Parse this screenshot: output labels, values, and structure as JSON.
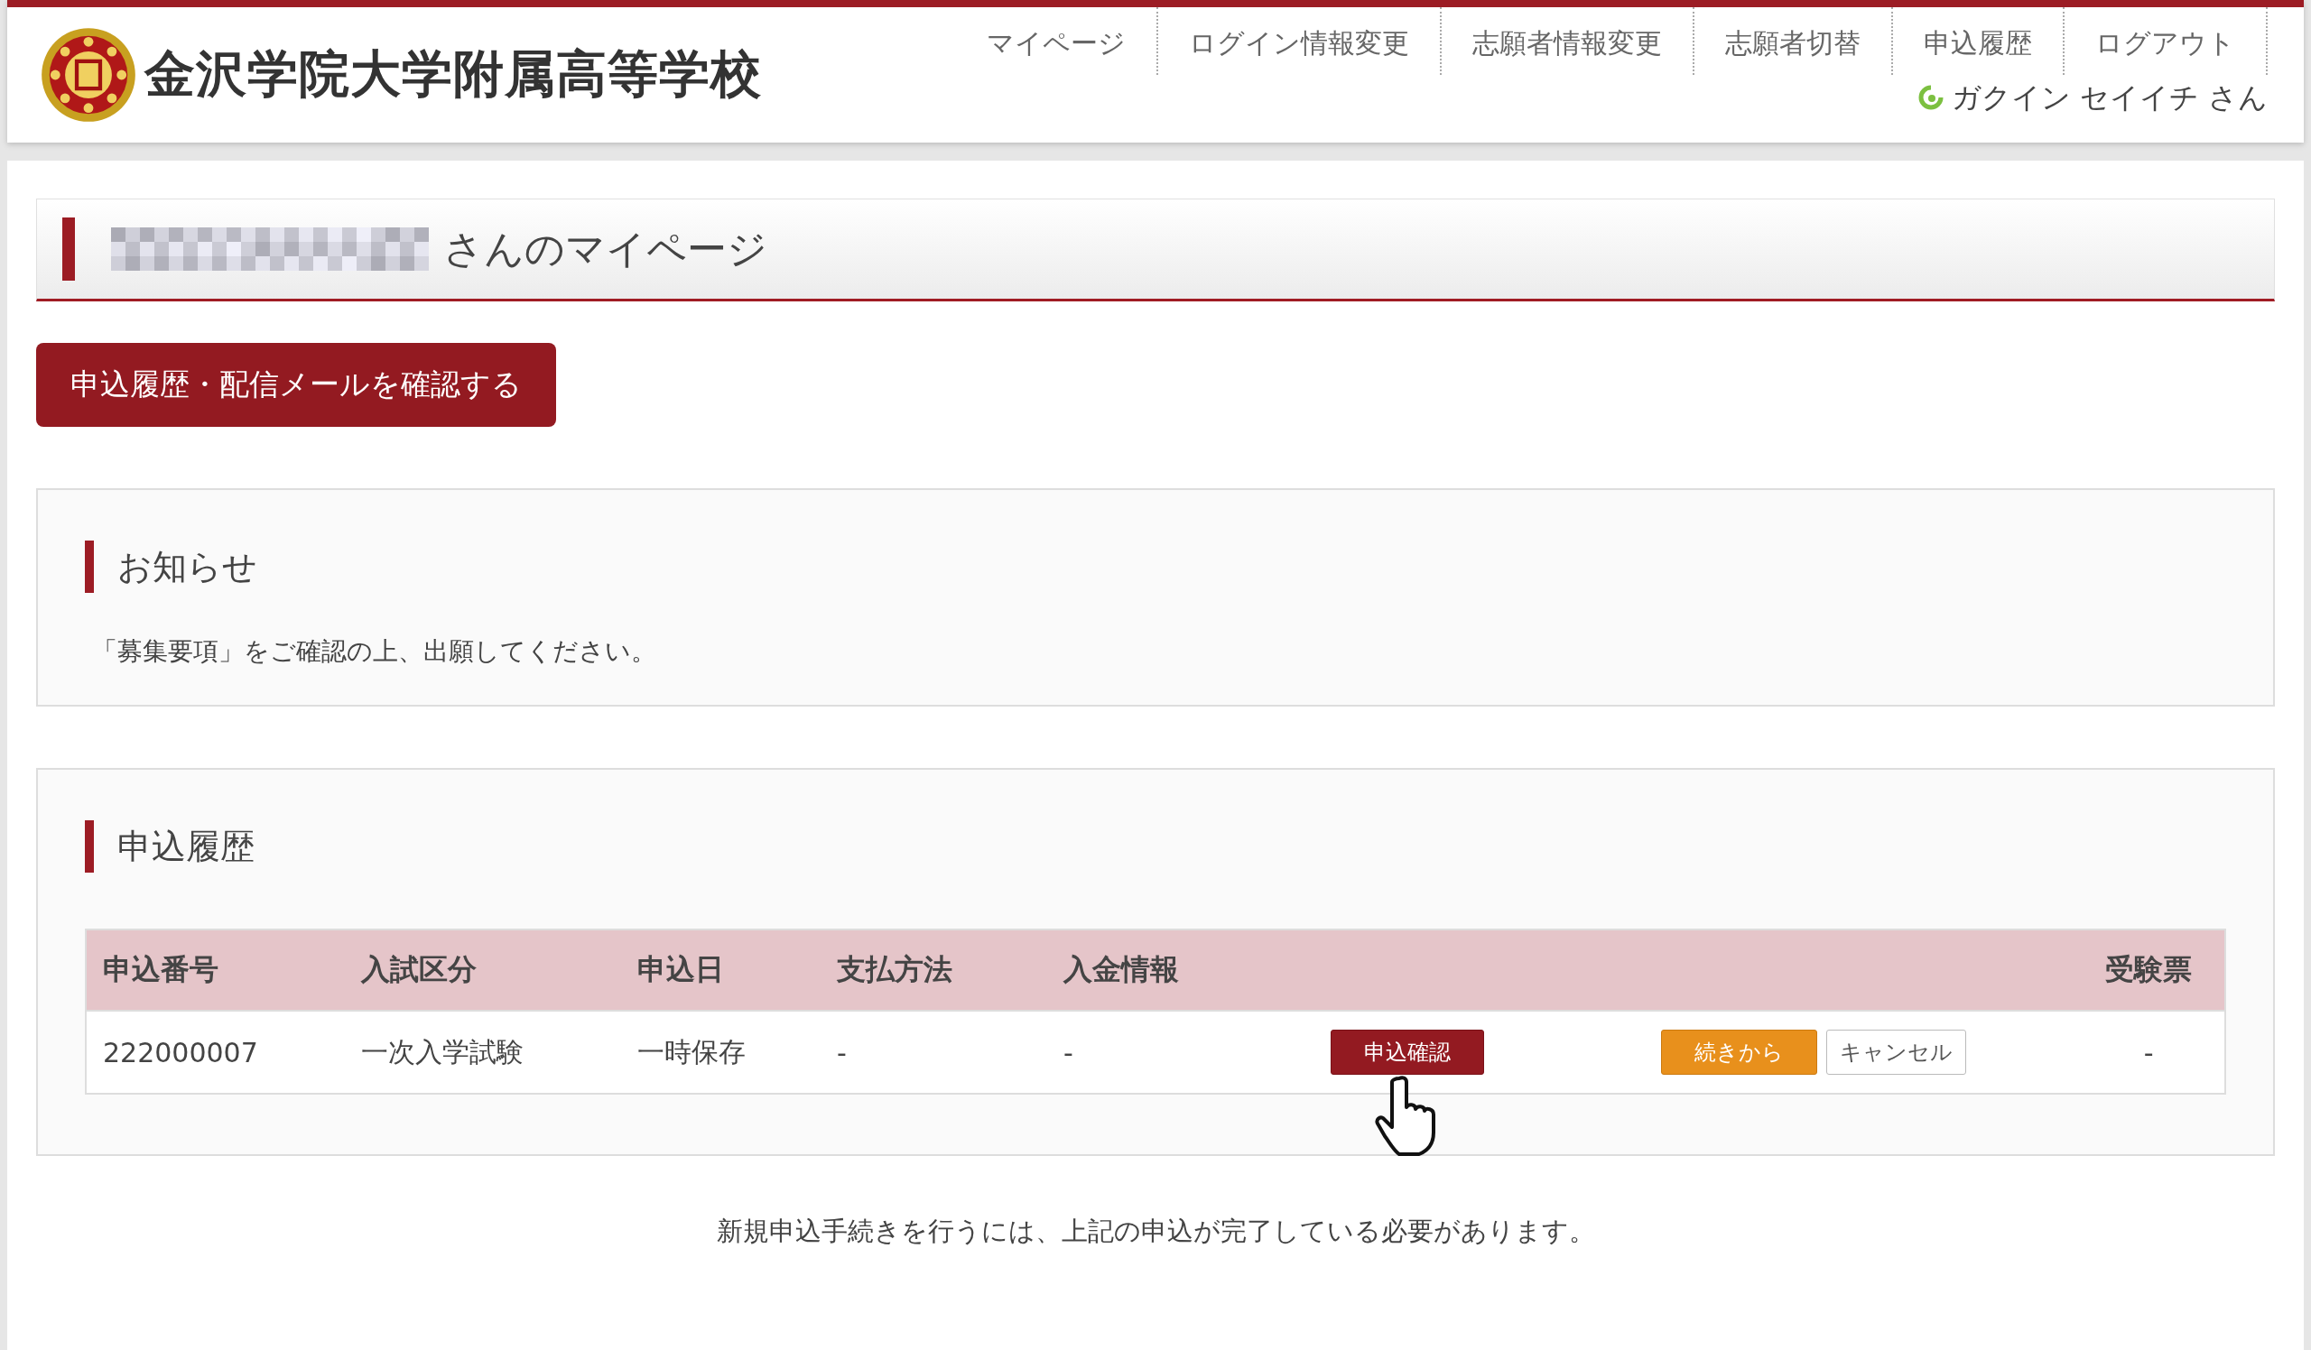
{
  "header": {
    "school_name": "金沢学院大学附属高等学校",
    "nav": [
      "マイページ",
      "ログイン情報変更",
      "志願者情報変更",
      "志願者切替",
      "申込履歴",
      "ログアウト"
    ],
    "user_greeting": "ガクイン セイイチ さん"
  },
  "page_title": "さんのマイページ",
  "history_button": "申込履歴・配信メールを確認する",
  "notice": {
    "heading": "お知らせ",
    "text": "「募集要項」をご確認の上、出願してください。"
  },
  "history": {
    "heading": "申込履歴",
    "table": {
      "columns": [
        "申込番号",
        "入試区分",
        "申込日",
        "支払方法",
        "入金情報",
        "受験票"
      ],
      "rows": [
        {
          "number": "222000007",
          "exam": "一次入学試験",
          "date": "一時保存",
          "payment": "-",
          "deposit": "-",
          "confirm_button": "申込確認",
          "continue_button": "続きから",
          "cancel_button": "キャンセル",
          "ticket": "-"
        }
      ]
    }
  },
  "footer_note": "新規申込手続きを行うには、上記の申込が完了している必要があります。"
}
